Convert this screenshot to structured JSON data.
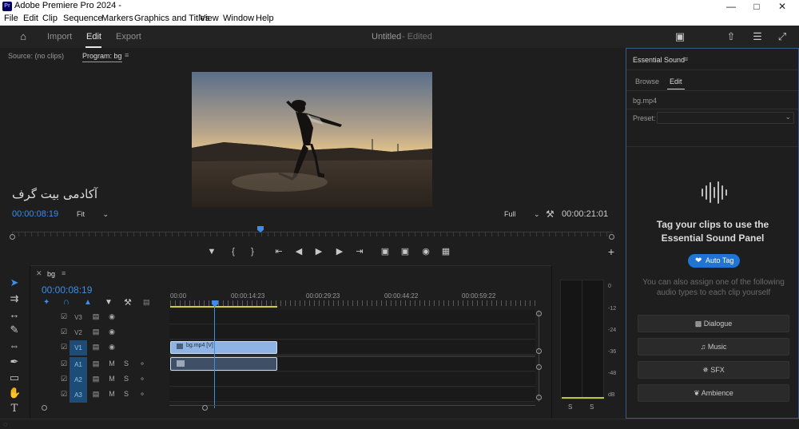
{
  "window": {
    "title": "Adobe Premiere Pro 2024 -",
    "app_icon": "Pr"
  },
  "menu": [
    "File",
    "Edit",
    "Clip",
    "Sequence",
    "Markers",
    "Graphics and Titles",
    "View",
    "Window",
    "Help"
  ],
  "workspace": {
    "tabs": [
      "Import",
      "Edit",
      "Export"
    ],
    "active": "Edit",
    "project": "Untitled",
    "status": "- Edited"
  },
  "program": {
    "source_tab": "Source: (no clips)",
    "program_tab": "Program: bg",
    "overlay_text": "آکادمی بیت گرف",
    "current_tc": "00:00:08:19",
    "fit": "Fit",
    "quality": "Full",
    "duration_tc": "00:00:21:01"
  },
  "timeline": {
    "sequence_tab": "bg",
    "current_tc": "00:00:08:19",
    "ruler": [
      "00:00",
      "00:00:14:23",
      "00:00:29:23",
      "00:00:44:22",
      "00:00:59:22"
    ],
    "tracks": [
      {
        "name": "V3",
        "kind": "video"
      },
      {
        "name": "V2",
        "kind": "video"
      },
      {
        "name": "V1",
        "kind": "video",
        "selected": true
      },
      {
        "name": "A1",
        "kind": "audio",
        "selected": true
      },
      {
        "name": "A2",
        "kind": "audio",
        "selected": true
      },
      {
        "name": "A3",
        "kind": "audio",
        "selected": true
      }
    ],
    "clip_video_label": "bg.mp4 [V]",
    "meter_scale": [
      "0",
      "-12",
      "-24",
      "-36",
      "-48",
      "dB"
    ],
    "meter_solo": [
      "S",
      "S"
    ]
  },
  "sound": {
    "panel_title": "Essential Sound",
    "tabs": [
      "Browse",
      "Edit"
    ],
    "clip": "bg.mp4",
    "preset_label": "Preset:",
    "heading": "Tag your clips to use the Essential Sound Panel",
    "auto_tag": "Auto Tag",
    "hint": "You can also assign one of the following audio types to each clip yourself",
    "types": [
      "Dialogue",
      "Music",
      "SFX",
      "Ambience"
    ]
  },
  "colors": {
    "accent": "#3b8ee8",
    "clip_video": "#8fb4e3",
    "track_selected": "#1d4c76"
  }
}
